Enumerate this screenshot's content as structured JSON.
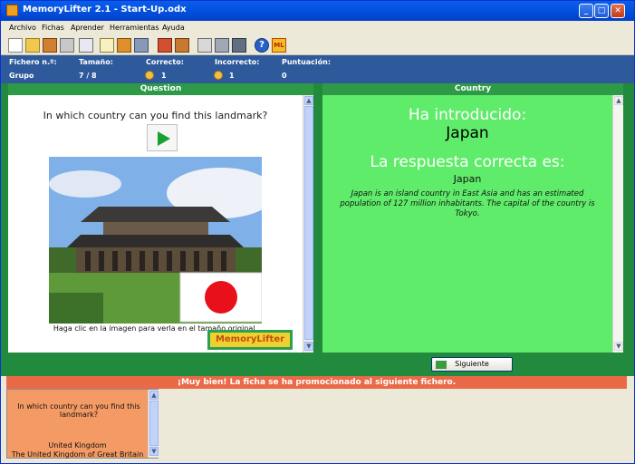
{
  "window": {
    "title": "MemoryLifter 2.1 - Start-Up.odx"
  },
  "menu": [
    "Archivo",
    "Fichas",
    "Aprender",
    "Herramientas",
    "Ayuda"
  ],
  "toolbar_icons": [
    "new-icon",
    "open-icon",
    "save-icon",
    "print-icon",
    "preview-icon",
    "edit-icon",
    "media-icon",
    "copy-icon",
    "learn-icon",
    "stack-icon",
    "info-icon",
    "tools-icon",
    "screen-icon",
    "help-icon",
    "ml-icon"
  ],
  "stats": {
    "file_label": "Fichero n.º:",
    "file_value": "Grupo",
    "size_label": "Tamaño:",
    "size_value": "7 / 8",
    "correct_label": "Correcto:",
    "correct_value": "1",
    "incorrect_label": "Incorrecto:",
    "incorrect_value": "1",
    "score_label": "Puntuación:",
    "score_value": "0"
  },
  "question_panel": {
    "header": "Question",
    "text": "In which country can you find this landmark?",
    "caption": "Haga clic en la imagen para verla en el tamaño original.",
    "logo_text": "MemoryLifter"
  },
  "answer_panel": {
    "header": "Country",
    "entered_label": "Ha introducido:",
    "entered_value": "Japan",
    "correct_label": "La respuesta correcta es:",
    "correct_value": "Japan",
    "description": "Japan is an island country in East Asia and has an estimated population of 127 million inhabitants. The capital of the country is Tokyo."
  },
  "next_button": "Siguiente",
  "status_message": "¡Muy bien! La ficha se ha promocionado al siguiente fichero.",
  "history": {
    "question": "In which country can you find this landmark?",
    "answer_line1": "United Kingdom",
    "answer_line2": "The United Kingdom of Great Britain"
  },
  "colors": {
    "stats_bar": "#2e5a9c",
    "green_bg": "#228a3c",
    "answer_bg": "#60ec6b",
    "status_bar": "#ea6a48",
    "history_card": "#f49a64"
  }
}
